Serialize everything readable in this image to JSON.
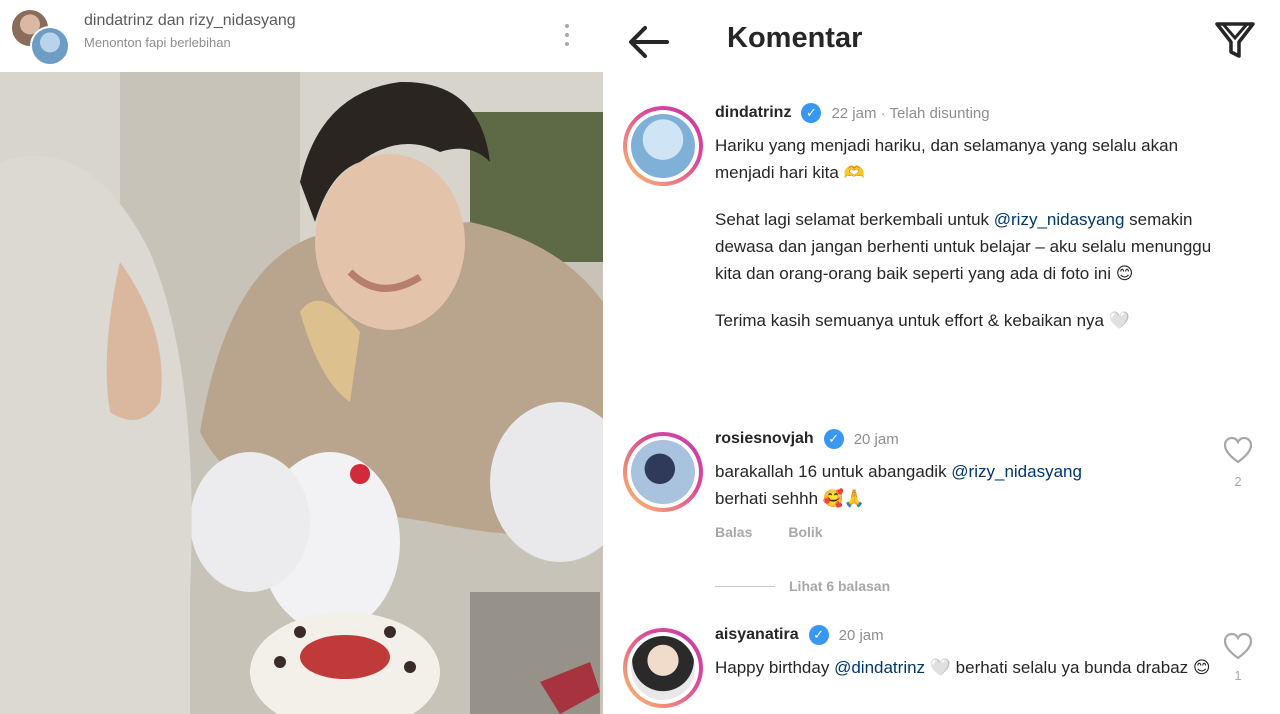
{
  "post": {
    "header_user": "dindatrinz dan rizy_nidasyang",
    "header_sub": "Menonton fapi berlebihan"
  },
  "comments_panel": {
    "title": "Komentar",
    "items": [
      {
        "username": "dindatrinz",
        "meta": "22 jam · Telah disunting",
        "text_1": "Hariku yang menjadi hariku, dan selamanya yang selalu akan menjadi hari kita ",
        "emoji_1": "🫶",
        "text_2": "Sehat lagi selamat berkembali untuk ",
        "mention_2": "@rizy_nidasyang",
        "text_2b": " semakin dewasa dan jangan berhenti untuk belajar – aku selalu menunggu kita dan orang-orang baik seperti yang ada di foto ini ",
        "emoji_2": "😊",
        "text_3": "Terima kasih semuanya untuk effort & kebaikan nya ",
        "emoji_3": "🤍"
      },
      {
        "username": "rosiesnovjah",
        "meta": "20 jam",
        "text_1": "barakallah 16 untuk abangadik ",
        "mention_1": "@rizy_nidasyang",
        "text_2": "berhati sehhh ",
        "emoji": "🥰🙏",
        "reply_label": "Balas",
        "translate_label": "Bolik",
        "like_count": "2"
      },
      {
        "username": "aisyanatira",
        "meta": "20 jam",
        "text_1": "Happy birthday ",
        "mention_1": "@dindatrinz",
        "text_2": " 🤍 berhati selalu ya bunda drabaz ",
        "emoji": "😊",
        "like_count": "1"
      }
    ],
    "view_replies_label": "Lihat 6 balasan"
  },
  "colors": {
    "verified": "#3897f0",
    "mention": "#00376b",
    "story_ring_start": "#fdc468",
    "story_ring_end": "#c837ab"
  },
  "icons": [
    "back-arrow-icon",
    "filter-icon",
    "more-icon",
    "verified-icon",
    "heart-icon"
  ]
}
